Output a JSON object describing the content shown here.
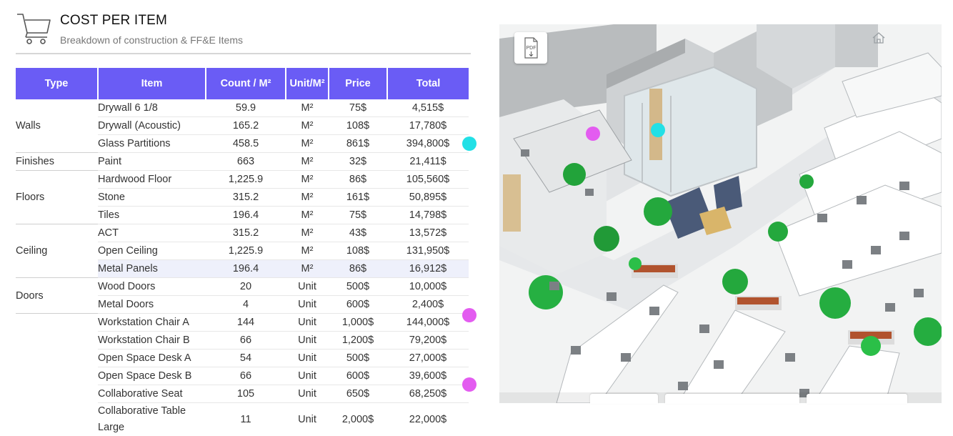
{
  "header": {
    "title": "COST PER ITEM",
    "subtitle": "Breakdown of construction & FF&E Items",
    "icon": "shopping-cart-icon"
  },
  "table": {
    "columns": [
      "Type",
      "Item",
      "Count / M²",
      "Unit/M²",
      "Price",
      "Total"
    ],
    "groups": [
      {
        "type": "Walls",
        "rows": [
          {
            "item": "Drywall 6 1/8",
            "count": "59.9",
            "unit": "M²",
            "price": "75$",
            "total": "4,515$"
          },
          {
            "item": "Drywall (Acoustic)",
            "count": "165.2",
            "unit": "M²",
            "price": "108$",
            "total": "17,780$"
          },
          {
            "item": "Glass Partitions",
            "count": "458.5",
            "unit": "M²",
            "price": "861$",
            "total": "394,800$"
          }
        ]
      },
      {
        "type": "Finishes",
        "rows": [
          {
            "item": "Paint",
            "count": "663",
            "unit": "M²",
            "price": "32$",
            "total": "21,411$"
          }
        ]
      },
      {
        "type": "Floors",
        "rows": [
          {
            "item": "Hardwood Floor",
            "count": "1,225.9",
            "unit": "M²",
            "price": "86$",
            "total": "105,560$"
          },
          {
            "item": "Stone",
            "count": "315.2",
            "unit": "M²",
            "price": "161$",
            "total": "50,895$"
          },
          {
            "item": "Tiles",
            "count": "196.4",
            "unit": "M²",
            "price": "75$",
            "total": "14,798$"
          }
        ]
      },
      {
        "type": "Ceiling",
        "rows": [
          {
            "item": "ACT",
            "count": "315.2",
            "unit": "M²",
            "price": "43$",
            "total": "13,572$"
          },
          {
            "item": "Open Ceiling",
            "count": "1,225.9",
            "unit": "M²",
            "price": "108$",
            "total": "131,950$"
          },
          {
            "item": "Metal Panels",
            "count": "196.4",
            "unit": "M²",
            "price": "86$",
            "total": "16,912$"
          }
        ]
      },
      {
        "type": "Doors",
        "rows": [
          {
            "item": "Wood Doors",
            "count": "20",
            "unit": "Unit",
            "price": "500$",
            "total": "10,000$"
          },
          {
            "item": "Metal Doors",
            "count": "4",
            "unit": "Unit",
            "price": "600$",
            "total": "2,400$"
          }
        ]
      },
      {
        "type": "",
        "rows": [
          {
            "item": "Workstation Chair A",
            "count": "144",
            "unit": "Unit",
            "price": "1,000$",
            "total": "144,000$"
          },
          {
            "item": "Workstation Chair B",
            "count": "66",
            "unit": "Unit",
            "price": "1,200$",
            "total": "79,200$"
          },
          {
            "item": "Open Space Desk A",
            "count": "54",
            "unit": "Unit",
            "price": "500$",
            "total": "27,000$"
          },
          {
            "item": "Open Space Desk B",
            "count": "66",
            "unit": "Unit",
            "price": "600$",
            "total": "39,600$"
          },
          {
            "item": "Collaborative Seat",
            "count": "105",
            "unit": "Unit",
            "price": "650$",
            "total": "68,250$"
          },
          {
            "item": "Collaborative Table Large",
            "count": "11",
            "unit": "Unit",
            "price": "2,000$",
            "total": "22,000$"
          }
        ]
      }
    ]
  },
  "markers": [
    {
      "color": "#22e0e6",
      "row": "Glass Partitions"
    },
    {
      "color": "#e35cf0",
      "row": "Workstation Chair A"
    },
    {
      "color": "#e35cf0",
      "row": "Collaborative Seat"
    }
  ],
  "viewer": {
    "pdf_label": "PDF",
    "pdf_icon": "pdf-download-icon",
    "home_icon": "home-icon",
    "scene_markers": [
      {
        "color": "#e35cf0"
      },
      {
        "color": "#22e0e6"
      }
    ]
  },
  "colors": {
    "accent": "#6a5cf5",
    "marker_cyan": "#22e0e6",
    "marker_magenta": "#e35cf0",
    "row_highlight": "#eef0fb"
  }
}
